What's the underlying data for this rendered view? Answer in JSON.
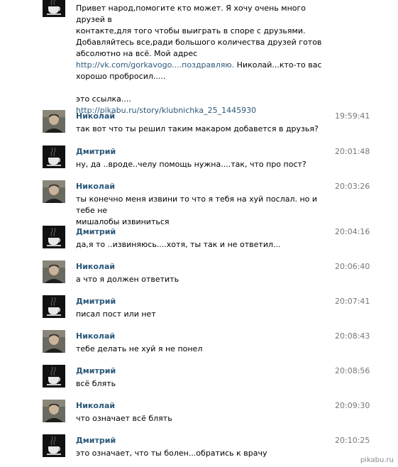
{
  "first_message": {
    "lines": [
      "Привет народ,помогите кто может. Я хочу очень много друзей в",
      "контакте,для того чтобы выиграть в споре с друзьями.",
      "Добавляйтесь все,ради большого количества друзей готов",
      "абсолютно на всё. Мой адрес"
    ],
    "link1": "http://vk.com/gorkavogo....поздравляю.",
    "after_link1": " Николай...кто-то вас",
    "line_6": "хорошо пробросил.....",
    "line_7": "это ссылка....",
    "link2": "http://pikabu.ru/story/klubnichka_25_1445930"
  },
  "messages": [
    {
      "author": "Николай",
      "time": "19:59:41",
      "lines": [
        "так вот что ты решил таким макаром добавется в друзья?"
      ]
    },
    {
      "author": "Дмитрий",
      "time": "20:01:48",
      "lines": [
        "ну, да ..вроде..челу помощь нужна....так, что про пост?"
      ]
    },
    {
      "author": "Николай",
      "time": "20:03:26",
      "lines": [
        "ты конечно меня извини то что я тебя на хуй послал. но и тебе не",
        "мишалобы извиниться"
      ]
    },
    {
      "author": "Дмитрий",
      "time": "20:04:16",
      "lines": [
        "да,я то ..извиняюсь....хотя, ты так и не ответил..."
      ]
    },
    {
      "author": "Николай",
      "time": "20:06:40",
      "lines": [
        "а что я должен ответить"
      ]
    },
    {
      "author": "Дмитрий",
      "time": "20:07:41",
      "lines": [
        "писал пост или нет"
      ]
    },
    {
      "author": "Николай",
      "time": "20:08:43",
      "lines": [
        "тебе делать не хуй я не понел"
      ]
    },
    {
      "author": "Дмитрий",
      "time": "20:08:56",
      "lines": [
        "всё блять"
      ]
    },
    {
      "author": "Николай",
      "time": "20:09:30",
      "lines": [
        "что означает всё блять"
      ]
    },
    {
      "author": "Дмитрий",
      "time": "20:10:25",
      "lines": [
        "это означает, что ты болен...обратись к врачу"
      ]
    }
  ],
  "watermark": "pikabu.ru",
  "colors": {
    "name": "#2b587a",
    "link": "#2b587a",
    "time": "#777777"
  }
}
